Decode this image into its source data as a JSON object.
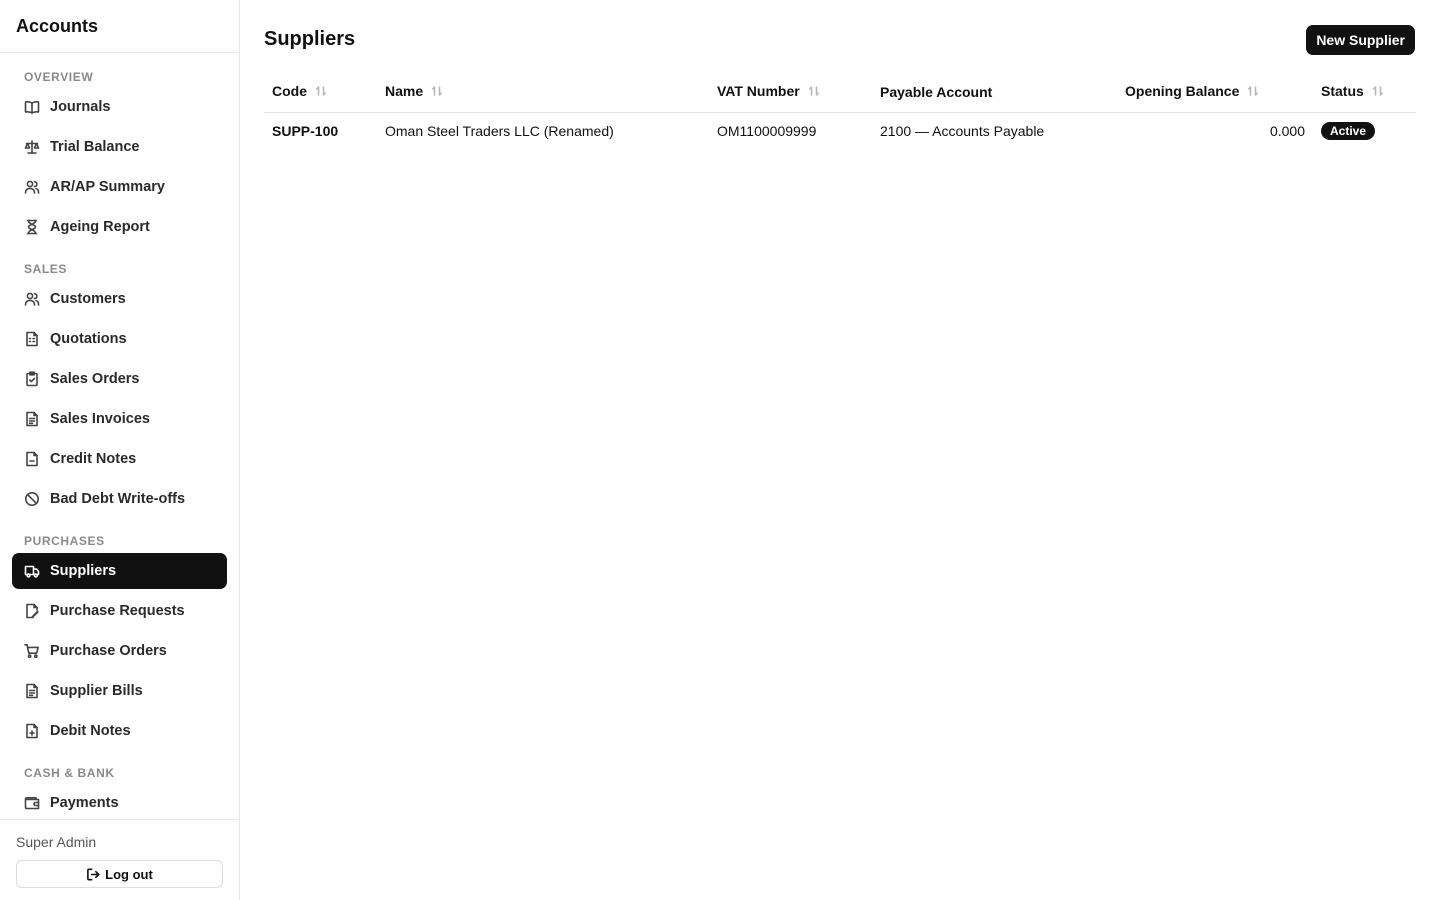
{
  "app": {
    "title": "Accounts"
  },
  "sidebar": {
    "sections": [
      {
        "label": "OVERVIEW"
      },
      {
        "label": "SALES"
      },
      {
        "label": "PURCHASES"
      },
      {
        "label": "CASH & BANK"
      }
    ],
    "items": [
      {
        "label": "Journals",
        "icon": "book-icon"
      },
      {
        "label": "Trial Balance",
        "icon": "scale-icon"
      },
      {
        "label": "AR/AP Summary",
        "icon": "users-icon"
      },
      {
        "label": "Ageing Report",
        "icon": "hourglass-icon"
      },
      {
        "label": "Customers",
        "icon": "users-icon"
      },
      {
        "label": "Quotations",
        "icon": "document-icon"
      },
      {
        "label": "Sales Orders",
        "icon": "clipboard-check-icon"
      },
      {
        "label": "Sales Invoices",
        "icon": "invoice-icon"
      },
      {
        "label": "Credit Notes",
        "icon": "file-minus-icon"
      },
      {
        "label": "Bad Debt Write-offs",
        "icon": "ban-icon"
      },
      {
        "label": "Suppliers",
        "icon": "truck-icon",
        "active": true
      },
      {
        "label": "Purchase Requests",
        "icon": "file-edit-icon"
      },
      {
        "label": "Purchase Orders",
        "icon": "cart-icon"
      },
      {
        "label": "Supplier Bills",
        "icon": "invoice-icon"
      },
      {
        "label": "Debit Notes",
        "icon": "file-plus-icon"
      },
      {
        "label": "Payments",
        "icon": "wallet-icon"
      }
    ],
    "footer": {
      "user": "Super Admin",
      "logout_label": "Log out"
    }
  },
  "main": {
    "title": "Suppliers",
    "new_button_label": "New Supplier",
    "table": {
      "columns": [
        "Code",
        "Name",
        "VAT Number",
        "Payable Account",
        "Opening Balance",
        "Status"
      ],
      "rows": [
        {
          "code": "SUPP-100",
          "name": "Oman Steel Traders LLC (Renamed)",
          "vat": "OM1100009999",
          "payable_account": "2100 — Accounts Payable",
          "opening_balance": "0.000",
          "status": "Active"
        }
      ]
    }
  }
}
